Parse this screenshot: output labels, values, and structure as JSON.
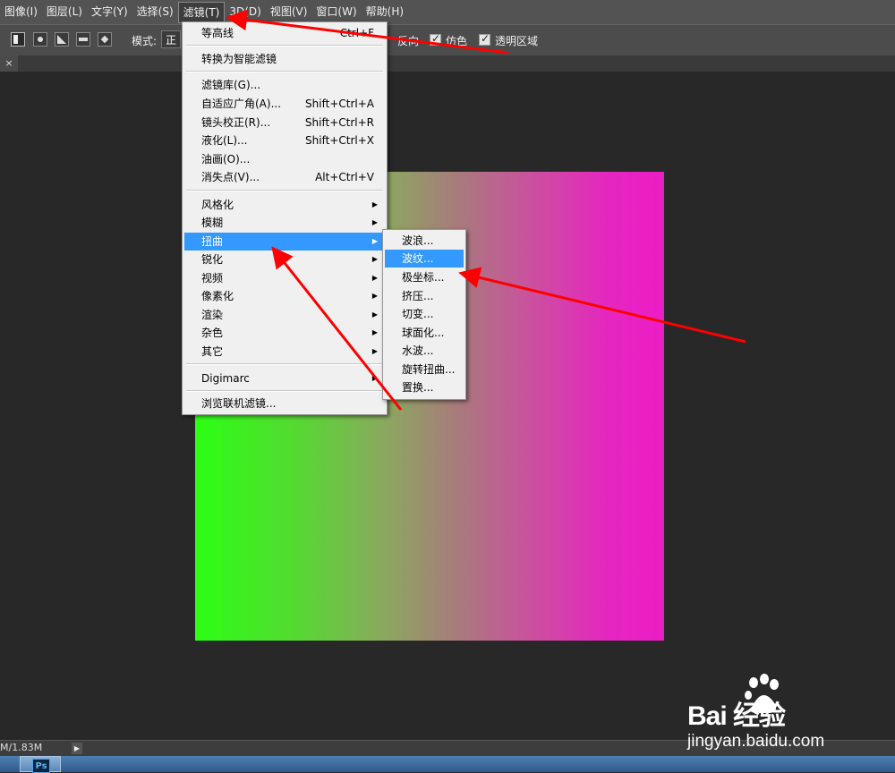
{
  "menubar": {
    "items": [
      {
        "label": "图像(I)"
      },
      {
        "label": "图层(L)"
      },
      {
        "label": "文字(Y)"
      },
      {
        "label": "选择(S)"
      },
      {
        "label": "滤镜(T)"
      },
      {
        "label": "3D(D)"
      },
      {
        "label": "视图(V)"
      },
      {
        "label": "窗口(W)"
      },
      {
        "label": "帮助(H)"
      }
    ]
  },
  "options": {
    "mode_label": "模式:",
    "mode_value": "正",
    "reverse_label": "反向",
    "dither_label": "仿色",
    "transparency_label": "透明区域"
  },
  "tab": {
    "close": "×"
  },
  "filter_menu": {
    "items": [
      {
        "label": "等高线",
        "shortcut": "Ctrl+F"
      },
      {
        "label": "转换为智能滤镜",
        "shortcut": ""
      },
      {
        "label": "滤镜库(G)...",
        "shortcut": ""
      },
      {
        "label": "自适应广角(A)...",
        "shortcut": "Shift+Ctrl+A"
      },
      {
        "label": "镜头校正(R)...",
        "shortcut": "Shift+Ctrl+R"
      },
      {
        "label": "液化(L)...",
        "shortcut": "Shift+Ctrl+X"
      },
      {
        "label": "油画(O)...",
        "shortcut": ""
      },
      {
        "label": "消失点(V)...",
        "shortcut": "Alt+Ctrl+V"
      },
      {
        "label": "风格化",
        "shortcut": ""
      },
      {
        "label": "模糊",
        "shortcut": ""
      },
      {
        "label": "扭曲",
        "shortcut": ""
      },
      {
        "label": "锐化",
        "shortcut": ""
      },
      {
        "label": "视频",
        "shortcut": ""
      },
      {
        "label": "像素化",
        "shortcut": ""
      },
      {
        "label": "渲染",
        "shortcut": ""
      },
      {
        "label": "杂色",
        "shortcut": ""
      },
      {
        "label": "其它",
        "shortcut": ""
      },
      {
        "label": "Digimarc",
        "shortcut": ""
      },
      {
        "label": "浏览联机滤镜...",
        "shortcut": ""
      }
    ],
    "arrow": "▶"
  },
  "distort_submenu": {
    "items": [
      {
        "label": "波浪..."
      },
      {
        "label": "波纹..."
      },
      {
        "label": "极坐标..."
      },
      {
        "label": "挤压..."
      },
      {
        "label": "切变..."
      },
      {
        "label": "球面化..."
      },
      {
        "label": "水波..."
      },
      {
        "label": "旋转扭曲..."
      },
      {
        "label": "置换..."
      }
    ]
  },
  "status": {
    "doc_size": "M/1.83M",
    "arrow": "▶"
  },
  "taskbar": {
    "app_icon": "Ps"
  },
  "watermark": {
    "brand": "Bai  经验",
    "url": "jingyan.baidu.com"
  },
  "colors": {
    "annotation_arrow": "#ff0000",
    "highlight": "#3399ff",
    "gradient_start": "#2cff14",
    "gradient_end": "#ec1dc6"
  }
}
